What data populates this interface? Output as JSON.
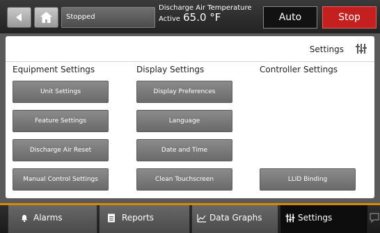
{
  "header": {
    "status": "Stopped",
    "temperature_label": "Discharge Air Temperature",
    "temperature_mode": "Active",
    "temperature_value": "65.0 °F",
    "auto_label": "Auto",
    "stop_label": "Stop"
  },
  "panel": {
    "title": "Settings",
    "columns": [
      {
        "heading": "Equipment Settings",
        "buttons": [
          "Unit Settings",
          "Feature Settings",
          "Discharge Air Reset",
          "Manual Control Settings"
        ]
      },
      {
        "heading": "Display Settings",
        "buttons": [
          "Display Preferences",
          "Language",
          "Date and Time",
          "Clean Touchscreen"
        ]
      },
      {
        "heading": "Controller Settings",
        "buttons": [
          "LLID Binding"
        ]
      }
    ]
  },
  "tabs": [
    {
      "label": "Alarms",
      "icon": "bell-icon"
    },
    {
      "label": "Reports",
      "icon": "document-icon"
    },
    {
      "label": "Data Graphs",
      "icon": "line-chart-icon"
    },
    {
      "label": "Settings",
      "icon": "settings-sliders-icon",
      "active": true
    }
  ],
  "colors": {
    "stop": "#c4201f",
    "accent": "#d98a00",
    "auto": "#121212"
  }
}
